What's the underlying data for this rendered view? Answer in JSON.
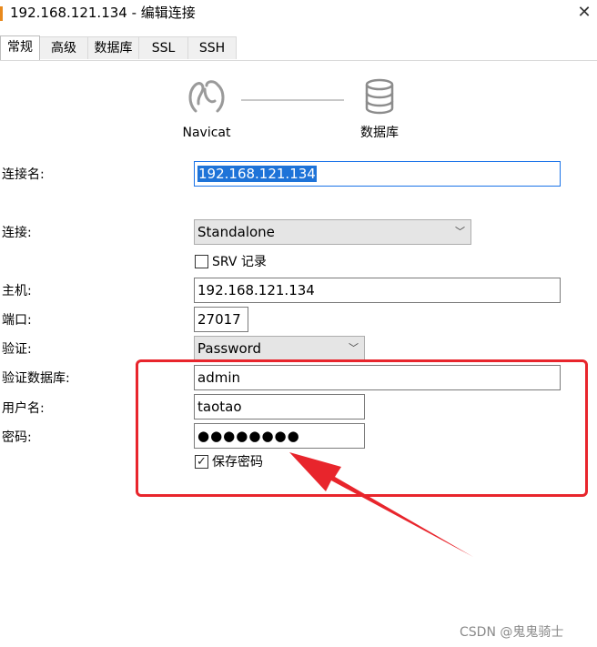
{
  "window": {
    "title": "192.168.121.134 - 编辑连接",
    "close_glyph": "✕"
  },
  "tabs": [
    {
      "label": "常规",
      "active": true
    },
    {
      "label": "高级",
      "active": false
    },
    {
      "label": "数据库",
      "active": false
    },
    {
      "label": "SSL",
      "active": false
    },
    {
      "label": "SSH",
      "active": false
    }
  ],
  "diagram": {
    "client_label": "Navicat",
    "server_label": "数据库",
    "client_icon": "navicat-icon",
    "server_icon": "database-icon"
  },
  "form": {
    "connection_name_label": "连接名:",
    "connection_name_value": "192.168.121.134",
    "connection_label": "连接:",
    "connection_value": "Standalone",
    "srv_label": "SRV 记录",
    "srv_checked": false,
    "host_label": "主机:",
    "host_value": "192.168.121.134",
    "port_label": "端口:",
    "port_value": "27017",
    "auth_label": "验证:",
    "auth_value": "Password",
    "auth_db_label": "验证数据库:",
    "auth_db_value": "admin",
    "username_label": "用户名:",
    "username_value": "taotao",
    "password_label": "密码:",
    "password_value": "●●●●●●●●",
    "save_password_label": "保存密码",
    "save_password_checked": true,
    "check_glyph": "✓",
    "dropdown_glyph": "﹀"
  },
  "annotation": {
    "color": "#e8252c"
  },
  "watermark": "CSDN @鬼鬼骑士"
}
